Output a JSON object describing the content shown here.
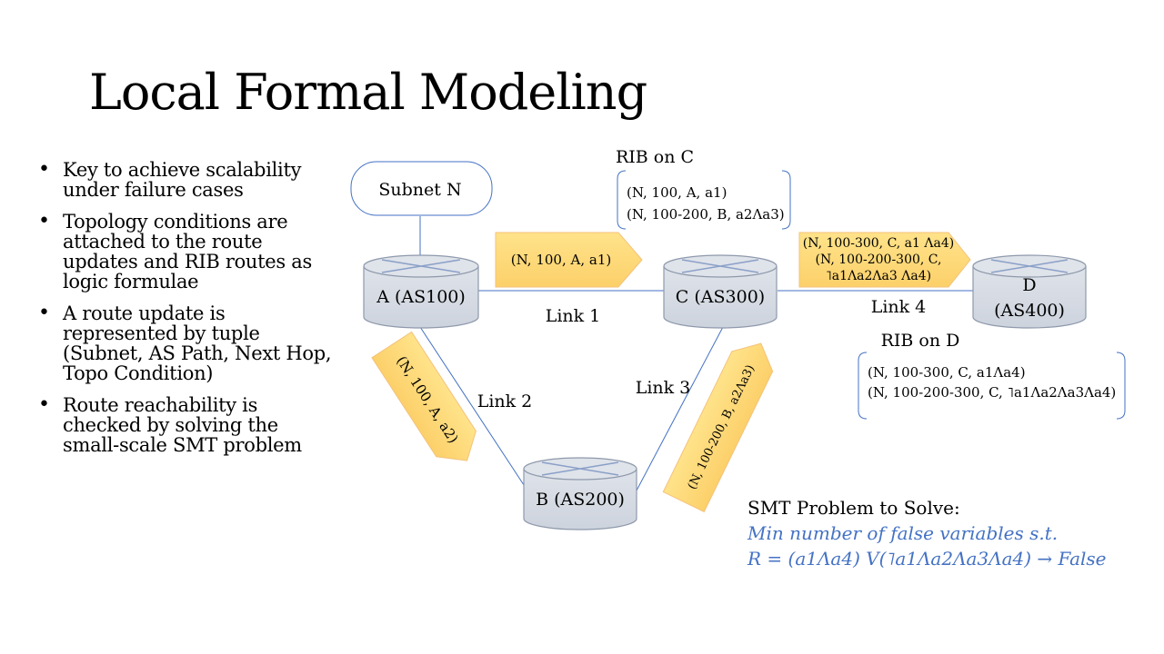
{
  "slide": {
    "title": "Local Formal Modeling"
  },
  "bullets": [
    "Key to achieve scalability under failure cases",
    "Topology conditions are attached to the route updates and RIB routes as logic formulae",
    "A route update is represented by tuple (Subnet, AS Path, Next Hop, Topo Condition)",
    "Route reachability is checked by solving the small-scale SMT problem"
  ],
  "diagram": {
    "subnet_label": "Subnet N",
    "routers": {
      "a": "A (AS100)",
      "b": "B (AS200)",
      "c": "C (AS300)",
      "d_line1": "D",
      "d_line2": "(AS400)"
    },
    "links": {
      "link1": "Link 1",
      "link2": "Link 2",
      "link3": "Link 3",
      "link4": "Link 4"
    },
    "updates": {
      "a_to_c": "(N, 100, A, a1)",
      "a_to_b": "(N, 100, A, a2)",
      "b_to_c": "(N, 100-200, B, a2Λa3)",
      "c_to_d_line1": "(N, 100-300, C, a1 Λa4)",
      "c_to_d_line2": "(N, 100-200-300, C,",
      "c_to_d_line3": "˥a1Λa2Λa3 Λa4)"
    },
    "rib_c": {
      "title": "RIB on C",
      "line1": "(N, 100, A, a1)",
      "line2": "(N, 100-200, B, a2Λa3)"
    },
    "rib_d": {
      "title": "RIB on D",
      "line1": "(N, 100-300, C, a1Λa4)",
      "line2": "(N, 100-200-300, C,  ˥a1Λa2Λa3Λa4)"
    }
  },
  "smt": {
    "title": "SMT Problem to Solve:",
    "line1": "Min number of false variables s.t.",
    "line2": "R = (a1Λa4) V(˥a1Λa2Λa3Λa4)  → False"
  },
  "colors": {
    "router_fill": "#d6dbe4",
    "router_stroke": "#8e99ab",
    "link_line": "#4472c4",
    "tag_fill": "#ffd966",
    "tag_stroke": "#f4b183",
    "bracket": "#4472c4",
    "accent_text": "#4472c4"
  }
}
